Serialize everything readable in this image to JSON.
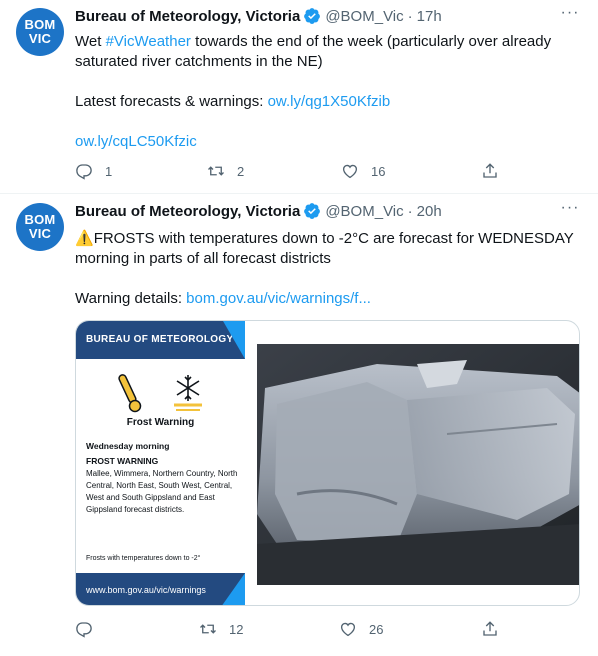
{
  "tweets": [
    {
      "avatar": {
        "line1": "BOM",
        "line2": "VIC"
      },
      "name": "Bureau of Meteorology, Victoria",
      "handle": "@BOM_Vic",
      "time": "17h",
      "text_before_tag": "Wet ",
      "hashtag": "#VicWeather",
      "text_after_tag": " towards the end of the week (particularly over already saturated river catchments in the NE)",
      "line2_prefix": "Latest forecasts & warnings: ",
      "link1": "ow.ly/qg1X50Kfzib",
      "link2": "ow.ly/cqLC50Kfzic",
      "replies": "1",
      "retweets": "2",
      "likes": "16"
    },
    {
      "avatar": {
        "line1": "BOM",
        "line2": "VIC"
      },
      "name": "Bureau of Meteorology, Victoria",
      "handle": "@BOM_Vic",
      "time": "20h",
      "warning_emoji": "⚠️",
      "text": "FROSTS with temperatures down to -2°C are forecast for WEDNESDAY morning in parts of all forecast districts",
      "details_prefix": "Warning details: ",
      "details_link": "bom.gov.au/vic/warnings/f...",
      "replies": "",
      "retweets": "12",
      "likes": "26",
      "card": {
        "header": "BUREAU OF METEOROLOGY",
        "title": "Frost Warning",
        "day": "Wednesday morning",
        "subtitle": "FROST WARNING",
        "areas": "Mallee, Wimmera, Northern Country, North Central, North East, South West, Central, West and South Gippsland and East Gippsland forecast districts.",
        "footnote": "Frosts with temperatures down to -2°",
        "url": "www.bom.gov.au/vic/warnings"
      }
    }
  ],
  "colors": {
    "link": "#1d9bf0",
    "avatar_bg": "#1d74c7",
    "bom_navy": "#234a80",
    "muted": "#536471"
  },
  "icons": [
    "verified-badge-icon",
    "more-icon",
    "reply-icon",
    "retweet-icon",
    "like-icon",
    "share-icon",
    "thermometer-icon",
    "snowflake-icon",
    "warning-emoji-icon"
  ]
}
